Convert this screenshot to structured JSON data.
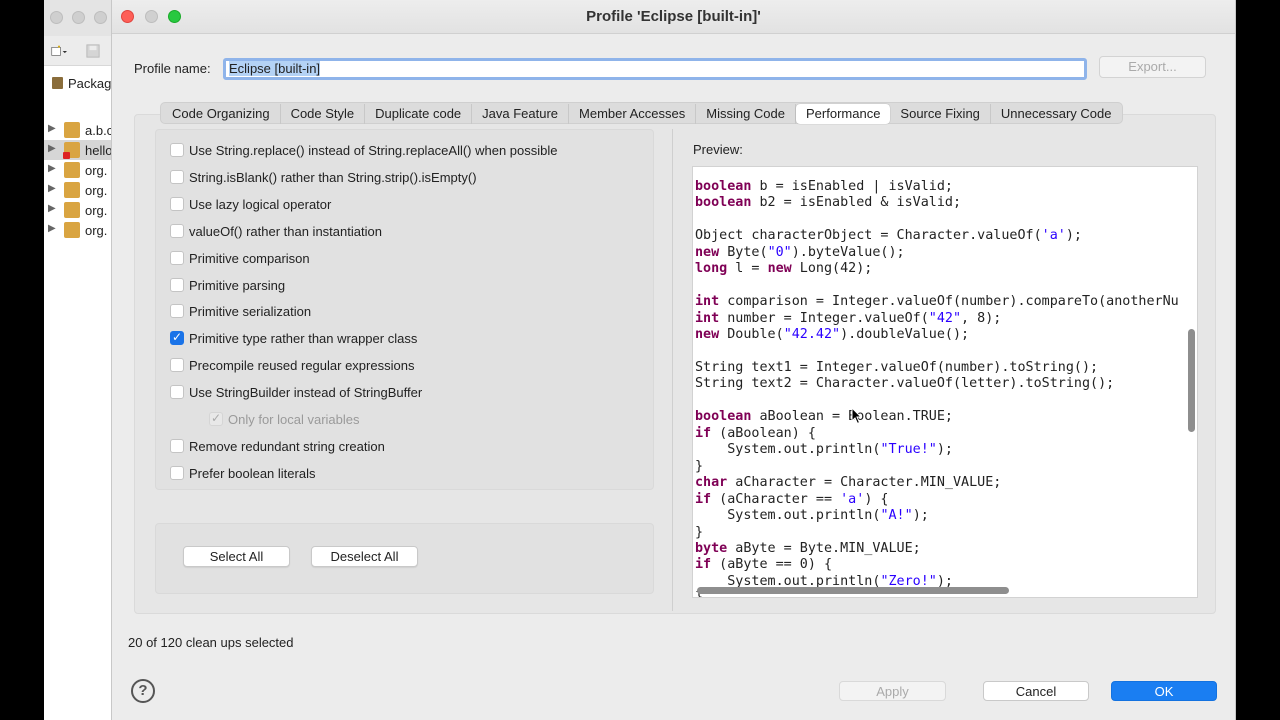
{
  "background_window": {
    "panel_title": "Packag",
    "tree_items": [
      {
        "label": "a.b.c",
        "selected": false,
        "error": false
      },
      {
        "label": "hello",
        "selected": true,
        "error": true
      },
      {
        "label": "org.",
        "selected": false,
        "error": false
      },
      {
        "label": "org.",
        "selected": false,
        "error": false
      },
      {
        "label": "org.",
        "selected": false,
        "error": false
      },
      {
        "label": "org.",
        "selected": false,
        "error": false
      }
    ]
  },
  "dialog": {
    "title": "Profile 'Eclipse [built-in]'",
    "profile_label": "Profile name:",
    "profile_value": "Eclipse [built-in]",
    "export_label": "Export...",
    "tabs": [
      {
        "label": "Code Organizing",
        "active": false
      },
      {
        "label": "Code Style",
        "active": false
      },
      {
        "label": "Duplicate code",
        "active": false
      },
      {
        "label": "Java Feature",
        "active": false
      },
      {
        "label": "Member Accesses",
        "active": false
      },
      {
        "label": "Missing Code",
        "active": false
      },
      {
        "label": "Performance",
        "active": true
      },
      {
        "label": "Source Fixing",
        "active": false
      },
      {
        "label": "Unnecessary Code",
        "active": false
      }
    ],
    "options": [
      {
        "label": "Use String.replace() instead of String.replaceAll() when possible",
        "checked": false,
        "disabled": false,
        "indent": false
      },
      {
        "label": "String.isBlank() rather than String.strip().isEmpty()",
        "checked": false,
        "disabled": false,
        "indent": false
      },
      {
        "label": "Use lazy logical operator",
        "checked": false,
        "disabled": false,
        "indent": false
      },
      {
        "label": "valueOf() rather than instantiation",
        "checked": false,
        "disabled": false,
        "indent": false
      },
      {
        "label": "Primitive comparison",
        "checked": false,
        "disabled": false,
        "indent": false
      },
      {
        "label": "Primitive parsing",
        "checked": false,
        "disabled": false,
        "indent": false
      },
      {
        "label": "Primitive serialization",
        "checked": false,
        "disabled": false,
        "indent": false
      },
      {
        "label": "Primitive type rather than wrapper class",
        "checked": true,
        "disabled": false,
        "indent": false
      },
      {
        "label": "Precompile reused regular expressions",
        "checked": false,
        "disabled": false,
        "indent": false
      },
      {
        "label": "Use StringBuilder instead of StringBuffer",
        "checked": false,
        "disabled": false,
        "indent": false
      },
      {
        "label": "Only for local variables",
        "checked": true,
        "disabled": true,
        "indent": true
      },
      {
        "label": "Remove redundant string creation",
        "checked": false,
        "disabled": false,
        "indent": false
      },
      {
        "label": "Prefer boolean literals",
        "checked": false,
        "disabled": false,
        "indent": false
      }
    ],
    "select_all_label": "Select All",
    "deselect_all_label": "Deselect All",
    "preview_label": "Preview:",
    "preview_code": [
      "boolean b = isEnabled | isValid;",
      "boolean b2 = isEnabled & isValid;",
      "",
      "Object characterObject = Character.valueOf('a');",
      "new Byte(\"0\").byteValue();",
      "long l = new Long(42);",
      "",
      "int comparison = Integer.valueOf(number).compareTo(anotherNu",
      "int number = Integer.valueOf(\"42\", 8);",
      "new Double(\"42.42\").doubleValue();",
      "",
      "String text1 = Integer.valueOf(number).toString();",
      "String text2 = Character.valueOf(letter).toString();",
      "",
      "boolean aBoolean = Boolean.TRUE;",
      "if (aBoolean) {",
      "    System.out.println(\"True!\");",
      "}",
      "char aCharacter = Character.MIN_VALUE;",
      "if (aCharacter == 'a') {",
      "    System.out.println(\"A!\");",
      "}",
      "byte aByte = Byte.MIN_VALUE;",
      "if (aByte == 0) {",
      "    System.out.println(\"Zero!\");",
      "}"
    ],
    "status": "20 of 120 clean ups selected",
    "help_label": "?",
    "apply_label": "Apply",
    "cancel_label": "Cancel",
    "ok_label": "OK",
    "colors": {
      "accent": "#1a7ef2",
      "keyword": "#7f0055",
      "string": "#2a00ff",
      "close_light": "#fe5f57",
      "minimize_light": "#d0d0d0",
      "zoom_light": "#28c840"
    }
  }
}
